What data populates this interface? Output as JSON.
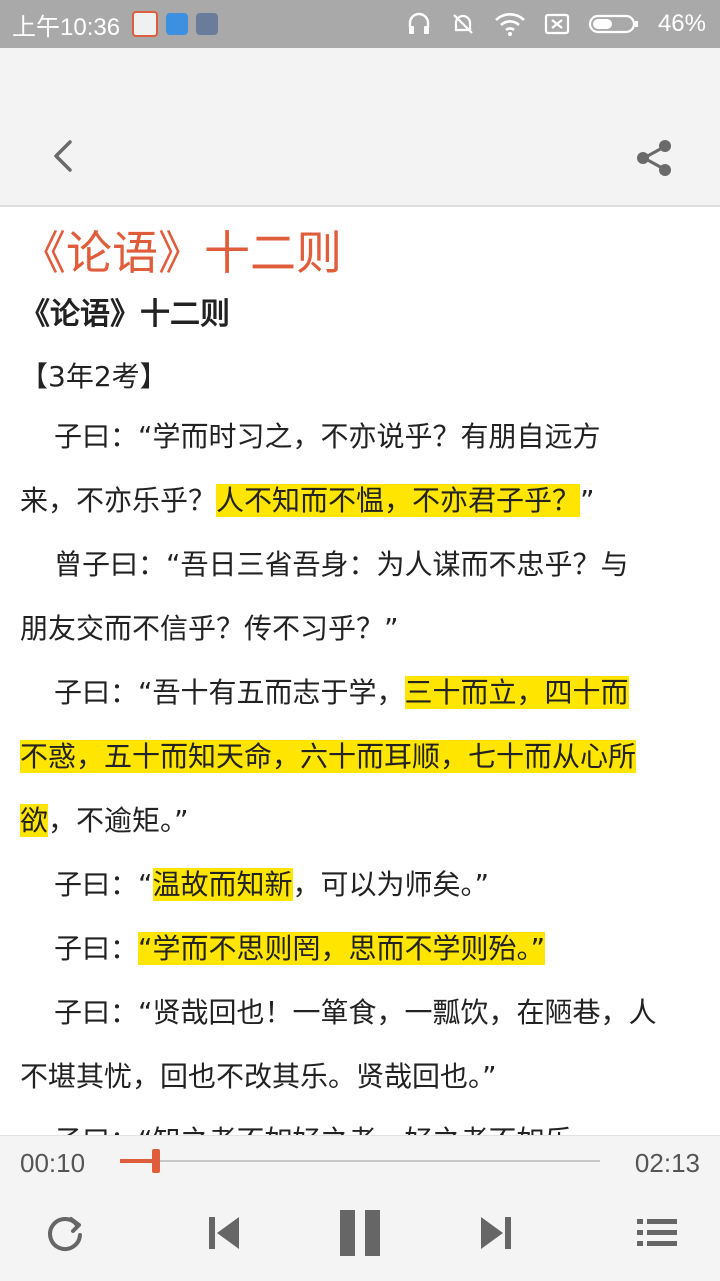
{
  "status_bar": {
    "time": "上午10:36",
    "battery_percent": "46%",
    "icons": [
      "app-notification-icon",
      "cloud-app-icon",
      "message-app-icon",
      "headset-icon",
      "mute-bell-icon",
      "wifi-icon",
      "no-sim-icon",
      "battery-icon"
    ]
  },
  "app_bar": {
    "back_icon": "chevron-left-icon",
    "share_icon": "share-icon"
  },
  "article": {
    "title": "《论语》十二则",
    "subtitle": "《论语》十二则",
    "tag": "【3年2考】",
    "highlight_color": "#ffe500",
    "title_color": "#e05d3c",
    "paragraphs": {
      "p1": {
        "l1": "子曰：“学而时习之，不亦说乎？有朋自远方",
        "l2a": "来，不亦乐乎？",
        "l2b": "人不知而不愠，不亦君子乎？",
        "l2c": "”"
      },
      "p2": {
        "l1": "曾子曰：“吾日三省吾身：为人谋而不忠乎？与",
        "l2": "朋友交而不信乎？传不习乎？”"
      },
      "p3": {
        "l1a": "子曰：“吾十有五而志于学，",
        "l1b": "三十而立，四十而",
        "l2": "不惑，五十而知天命，六十而耳顺，七十而从心所",
        "l3a": "欲",
        "l3b": "，不逾矩。”"
      },
      "p4": {
        "l1a": "子曰：“",
        "l1b": "温故而知新",
        "l1c": "，可以为师矣。”"
      },
      "p5": {
        "l1a": "子曰：",
        "l1b": "“学而不思则罔，思而不学则殆。”"
      },
      "p6": {
        "l1": "子曰：“贤哉回也！一箪食，一瓢饮，在陋巷，人",
        "l2": "不堪其忧，回也不改其乐。贤哉回也。”"
      },
      "p7": {
        "l1": "子曰：“知之者不如好之者，好之者不如乐"
      }
    }
  },
  "player": {
    "current_time": "00:10",
    "total_time": "02:13",
    "progress_fraction": 0.075,
    "accent_color": "#e05d3c",
    "controls": [
      "repeat-icon",
      "previous-track-icon",
      "pause-icon",
      "next-track-icon",
      "playlist-icon"
    ]
  }
}
